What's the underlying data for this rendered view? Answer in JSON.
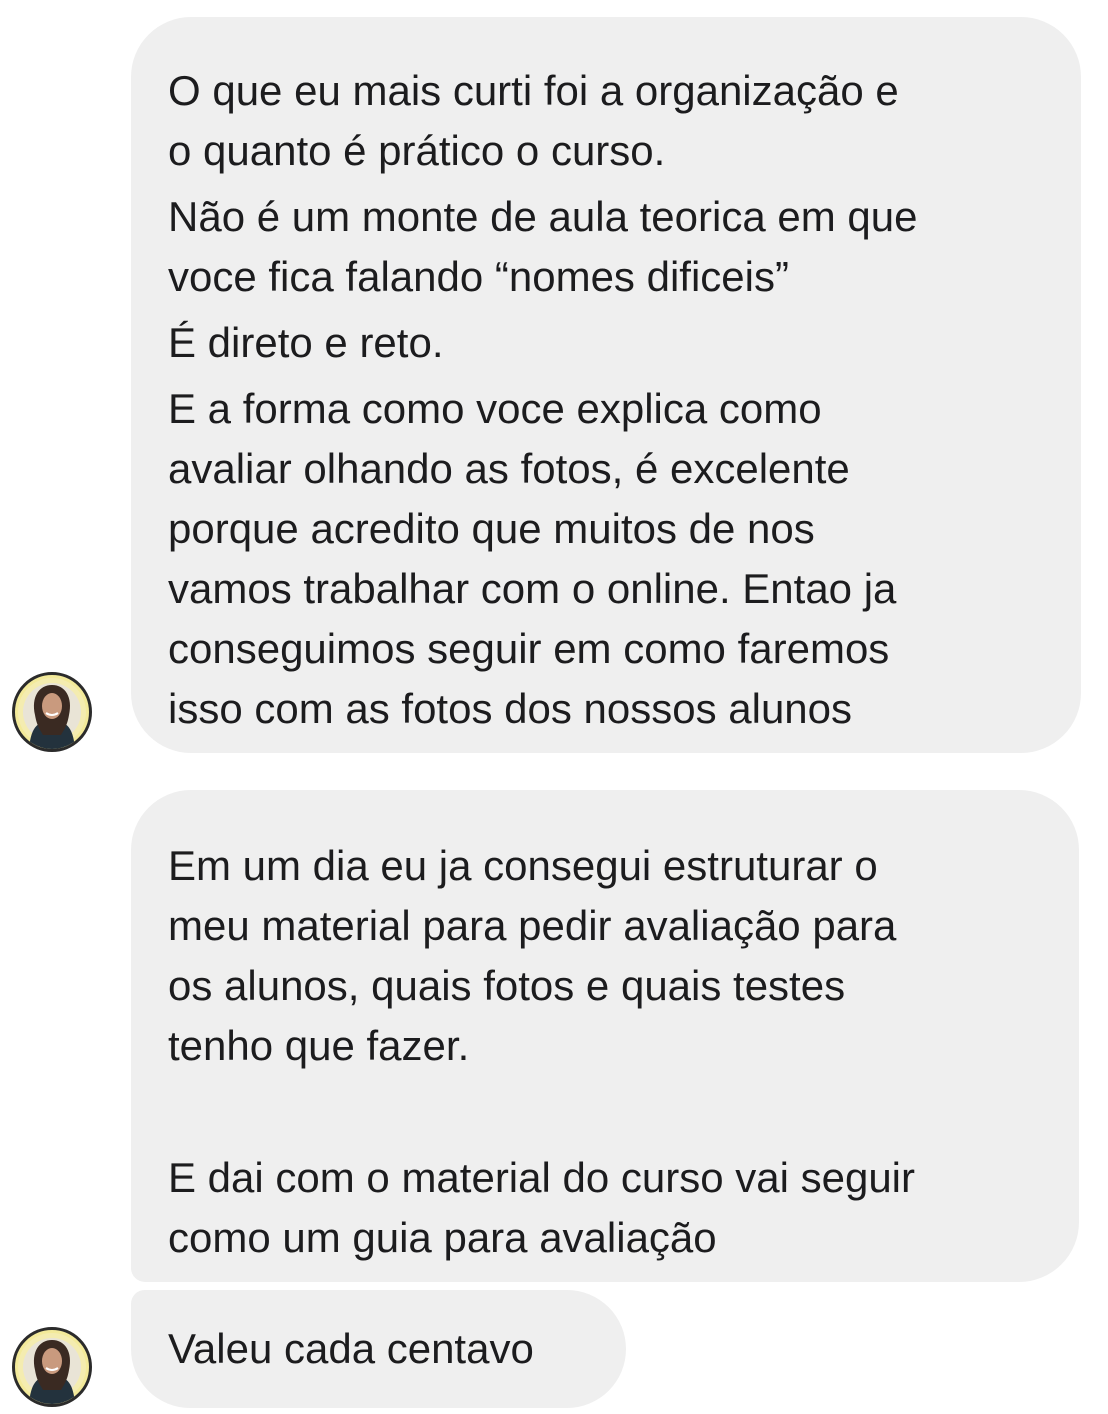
{
  "conversation": {
    "messages": [
      {
        "paragraphs": [
          {
            "lines": [
              "O que eu mais curti foi a organização e",
              "o quanto é prático o curso."
            ]
          },
          {
            "lines": [
              "Não é um monte de aula teorica em que",
              "voce fica falando “nomes dificeis”"
            ]
          },
          {
            "lines": [
              "É direto e reto."
            ]
          },
          {
            "lines": [
              "E a forma como voce explica como",
              "avaliar olhando as fotos, é excelente",
              "porque acredito que muitos de nos",
              "vamos trabalhar com o online. Entao ja",
              "conseguimos seguir em como faremos",
              "isso com as fotos dos nossos alunos"
            ]
          }
        ]
      },
      {
        "paragraphs": [
          {
            "lines": [
              "Em um dia eu ja consegui estruturar o",
              "meu material para pedir avaliação para",
              "os alunos, quais fotos e quais testes",
              "tenho que fazer."
            ]
          },
          {
            "lines": [
              "E dai com o material do curso vai seguir",
              "como um guia para avaliação"
            ]
          }
        ]
      },
      {
        "paragraphs": [
          {
            "lines": [
              "Valeu cada centavo"
            ]
          }
        ]
      }
    ],
    "avatar_icon": "user-avatar-photo",
    "colors": {
      "bubble_background": "#efefef",
      "text": "#1c1c1e",
      "avatar_ring": "#f3ea9a"
    }
  }
}
